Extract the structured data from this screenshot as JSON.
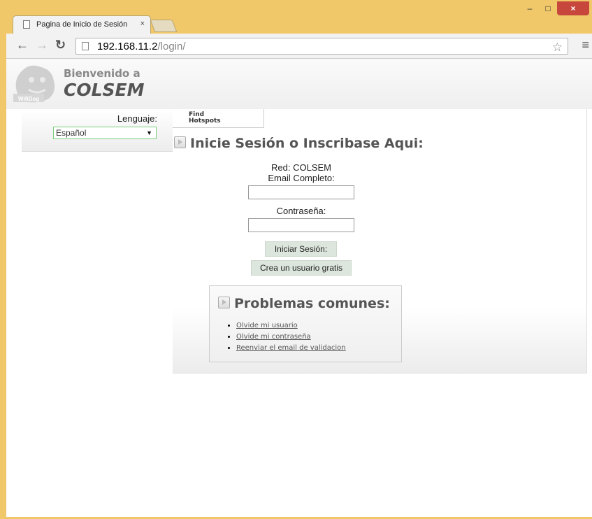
{
  "browser": {
    "tab_title": "Pagina de Inicio de Sesión",
    "tab_close": "×",
    "url_host": "192.168.11.2",
    "url_path": "/login/",
    "window_buttons": {
      "minimize": "–",
      "maximize": "□",
      "close": "×"
    }
  },
  "header": {
    "welcome": "Bienvenido a",
    "brand": "COLSEM",
    "logo_text": "WifiDog"
  },
  "language": {
    "label": "Lenguaje:",
    "selected": "Español"
  },
  "hotspots_tab": {
    "line1": "Find",
    "line2": "Hotspots"
  },
  "login": {
    "title": "Inicie Sesión o Inscribase Aqui:",
    "network": "Red: COLSEM",
    "email_label": "Email Completo:",
    "email_value": "",
    "password_label": "Contraseña:",
    "password_value": "",
    "login_button": "Iniciar Sesión:",
    "create_button": "Crea un usuario gratis"
  },
  "problems": {
    "title": "Problemas comunes:",
    "links": [
      "Olvide mi usuario",
      "Olvide mi contraseña",
      "Reenviar el email de validacion"
    ]
  },
  "colors": {
    "window_frame": "#f0c86a",
    "close_button": "#c7473c",
    "button_bg": "#dde6dd",
    "select_border": "#77cc77"
  }
}
